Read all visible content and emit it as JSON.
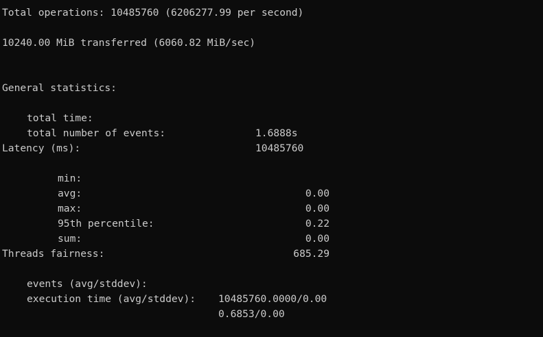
{
  "summary": {
    "total_operations_label": "Total operations:",
    "total_operations_value": "10485760",
    "total_operations_rate": "(6206277.99 per second)",
    "transferred_amount": "10240.00 MiB",
    "transferred_label": "transferred",
    "transferred_rate": "(6060.82 MiB/sec)"
  },
  "general": {
    "heading": "General statistics:",
    "total_time_label": "total time:",
    "total_time_value": "1.6888s",
    "total_events_label": "total number of events:",
    "total_events_value": "10485760"
  },
  "latency": {
    "heading": "Latency (ms):",
    "rows": [
      {
        "label": "min:",
        "value": "0.00"
      },
      {
        "label": "avg:",
        "value": "0.00"
      },
      {
        "label": "max:",
        "value": "0.22"
      },
      {
        "label": "95th percentile:",
        "value": "0.00"
      },
      {
        "label": "sum:",
        "value": "685.29"
      }
    ]
  },
  "fairness": {
    "heading": "Threads fairness:",
    "events_label": "events (avg/stddev):",
    "events_value": "10485760.0000/0.00",
    "exec_label": "execution time (avg/stddev):",
    "exec_value": "0.6853/0.00"
  }
}
